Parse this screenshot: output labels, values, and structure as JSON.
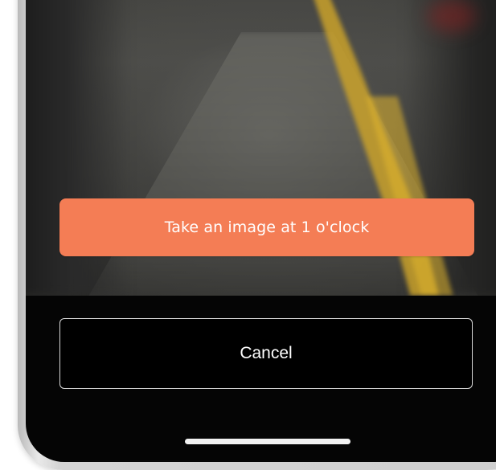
{
  "prompt": {
    "text": "Take an image at 1 o'clock",
    "color": "#f47d55"
  },
  "actions": {
    "cancel_label": "Cancel"
  },
  "camera": {
    "description_hidden": ""
  }
}
